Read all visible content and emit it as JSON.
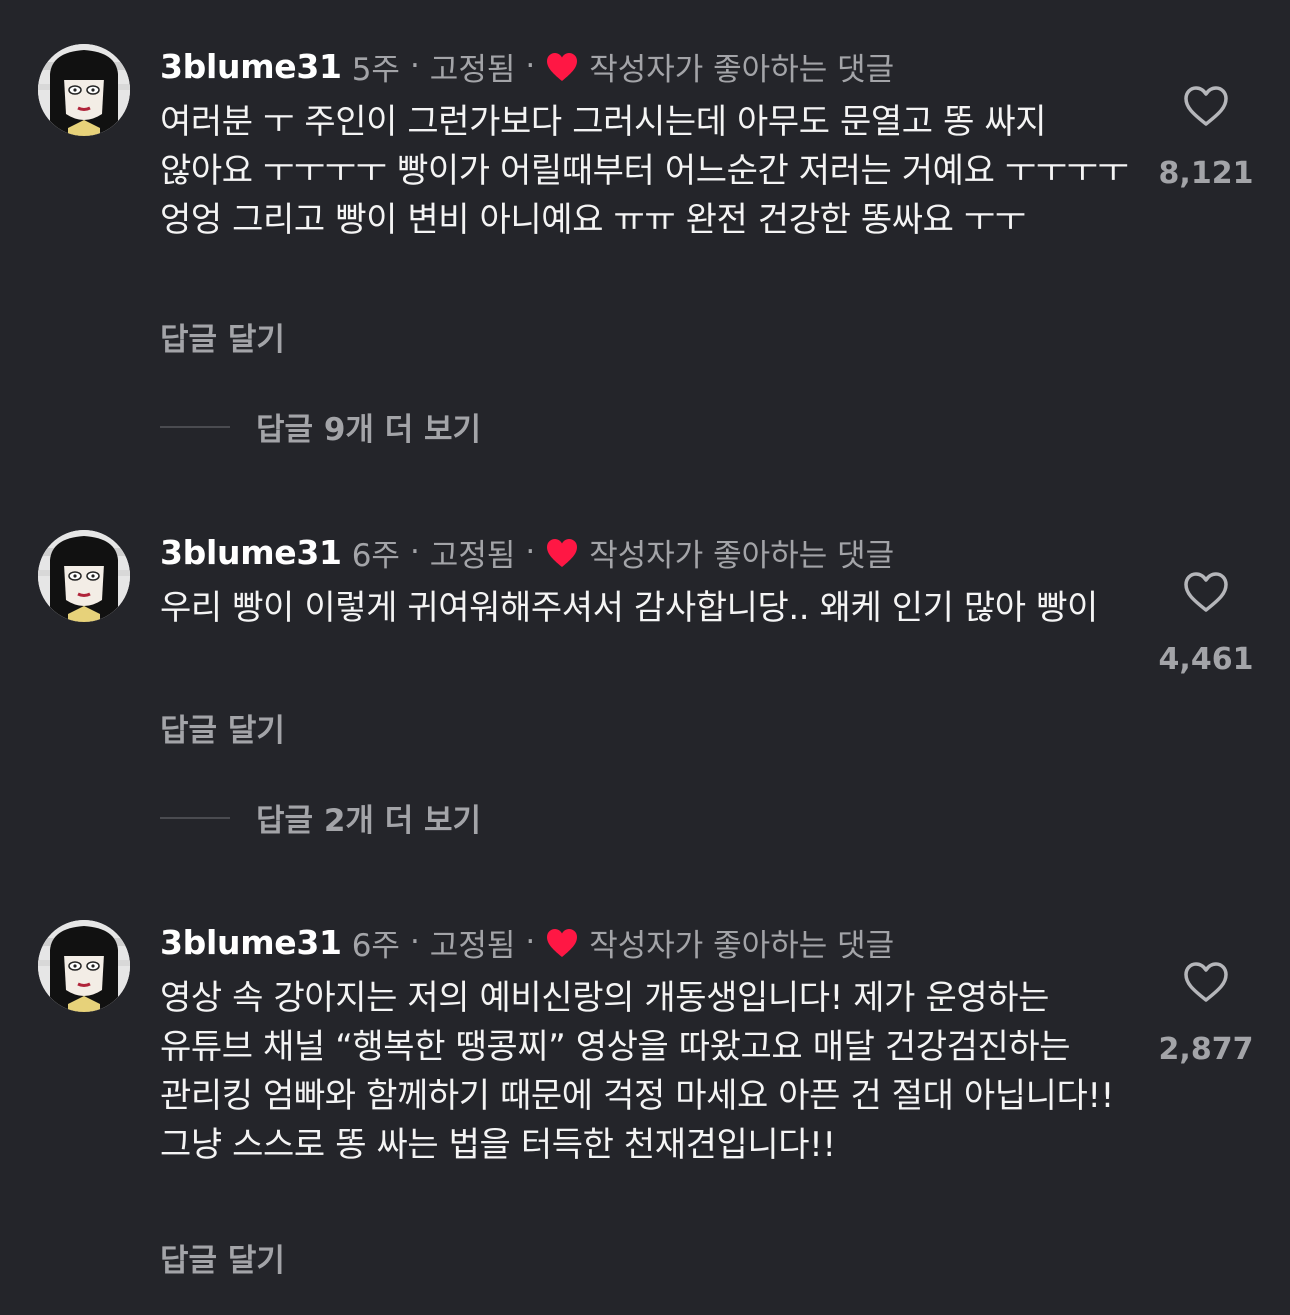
{
  "colors": {
    "background": "#24252a",
    "text": "#f4f4f4",
    "secondary": "#a3a4a8",
    "creator_heart": "#ff1744"
  },
  "comments": [
    {
      "username": "3blume31",
      "time": "5주",
      "separator": "·",
      "pinned": "고정됨",
      "creator_liked": "작성자가 좋아하는 댓글",
      "text": "여러분 ㅜ 주인이 그런가보다 그러시는데 아무도 문열고 똥 싸지 않아요 ㅜㅜㅜㅜ 빵이가 어릴때부터 어느순간 저러는 거예요 ㅜㅜㅜㅜ 엉엉 그리고 빵이 변비 아니예요 ㅠㅠ 완전 건강한 똥싸요 ㅜㅜ",
      "likes": "8,121",
      "reply": "답글 달기",
      "view_replies": "답글 9개 더 보기"
    },
    {
      "username": "3blume31",
      "time": "6주",
      "separator": "·",
      "pinned": "고정됨",
      "creator_liked": "작성자가 좋아하는 댓글",
      "text": "우리 빵이 이렇게 귀여워해주셔서 감사합니당.. 왜케 인기 많아 빵이",
      "likes": "4,461",
      "reply": "답글 달기",
      "view_replies": "답글 2개 더 보기"
    },
    {
      "username": "3blume31",
      "time": "6주",
      "separator": "·",
      "pinned": "고정됨",
      "creator_liked": "작성자가 좋아하는 댓글",
      "text": "영상 속 강아지는 저의 예비신랑의 개동생입니다! 제가 운영하는 유튜브 채널 “행복한 땡콩찌” 영상을 따왔고요 매달 건강검진하는 관리킹 엄빠와 함께하기 때문에 걱정 마세요 아픈 건 절대 아닙니다!! 그냥 스스로 똥 싸는 법을 터득한 천재견입니다!!",
      "likes": "2,877",
      "reply": "답글 달기"
    }
  ],
  "icons": {
    "like": "heart-outline-icon",
    "creator_like": "heart-filled-icon",
    "avatar": "cartoon-avatar"
  }
}
